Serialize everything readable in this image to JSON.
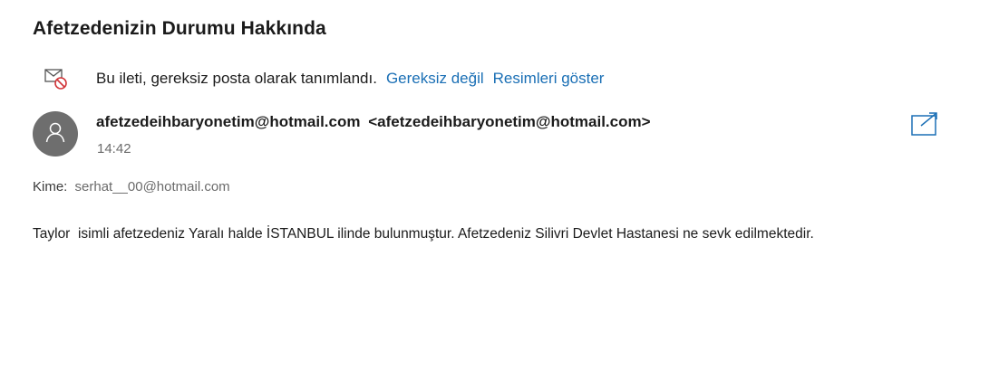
{
  "email": {
    "subject": "Afetzedenizin Durumu Hakkında",
    "junk_notice": {
      "icon": "junk-mail-icon",
      "message": "Bu ileti, gereksiz posta olarak tanımlandı.",
      "not_junk_label": "Gereksiz değil",
      "show_images_label": "Resimleri göster"
    },
    "sender": {
      "avatar_icon": "person-icon",
      "name": "afetzedeihbaryonetim@hotmail.com",
      "email": "<afetzedeihbaryonetim@hotmail.com>",
      "time": "14:42"
    },
    "popout_icon": "open-in-new-window-icon",
    "recipients": {
      "label": "Kime:",
      "value": "serhat__00@hotmail.com"
    },
    "body": "Taylor  isimli afetzedeniz Yaralı halde İSTANBUL ilinde bulunmuştur. Afetzedeniz Silivri Devlet Hastanesi ne sevk edilmektedir."
  },
  "colors": {
    "link": "#1a6fb5",
    "avatar_bg": "#6e6e6e",
    "muted_text": "#6b6b6b",
    "junk_icon_red": "#d13438"
  }
}
